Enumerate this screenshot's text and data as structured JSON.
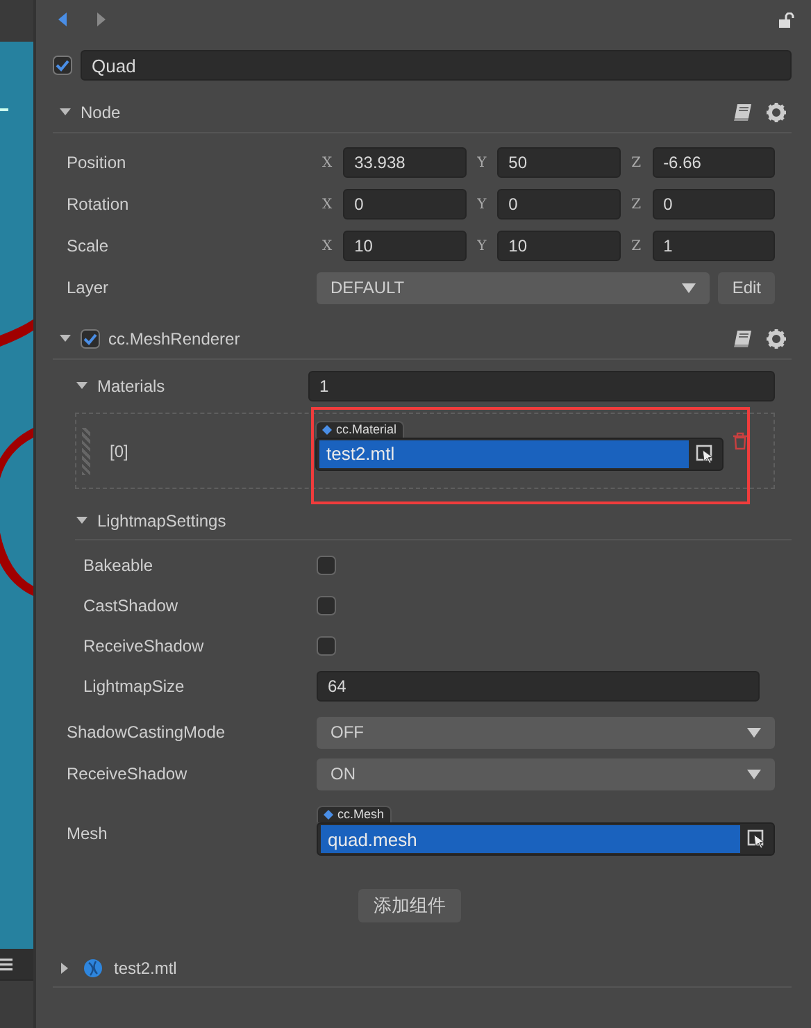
{
  "node": {
    "enabled": true,
    "name": "Quad"
  },
  "sections": [
    {
      "title": "Node",
      "expanded": true,
      "rows": [
        {
          "kind": "vec3",
          "label": "Position",
          "axes": [
            {
              "axis": "X",
              "value": "33.938"
            },
            {
              "axis": "Y",
              "value": "50"
            },
            {
              "axis": "Z",
              "value": "-6.66"
            }
          ]
        },
        {
          "kind": "vec3",
          "label": "Rotation",
          "axes": [
            {
              "axis": "X",
              "value": "0"
            },
            {
              "axis": "Y",
              "value": "0"
            },
            {
              "axis": "Z",
              "value": "0"
            }
          ]
        },
        {
          "kind": "vec3",
          "label": "Scale",
          "axes": [
            {
              "axis": "X",
              "value": "10"
            },
            {
              "axis": "Y",
              "value": "10"
            },
            {
              "axis": "Z",
              "value": "1"
            }
          ]
        },
        {
          "kind": "select",
          "label": "Layer",
          "value": "DEFAULT",
          "button": "Edit"
        }
      ]
    },
    {
      "title": "cc.MeshRenderer",
      "expanded": true,
      "enabled": true,
      "rows": [
        {
          "kind": "array",
          "label": "Materials",
          "expanded": true,
          "count": "1",
          "items": [
            {
              "index": "[0]",
              "type": "cc.Material",
              "value": "test2.mtl",
              "highlighted": true
            }
          ]
        },
        {
          "kind": "group",
          "label": "LightmapSettings",
          "expanded": true,
          "children": [
            {
              "kind": "checkbox",
              "label": "Bakeable",
              "checked": false
            },
            {
              "kind": "checkbox",
              "label": "CastShadow",
              "checked": false
            },
            {
              "kind": "checkbox",
              "label": "ReceiveShadow",
              "checked": false
            },
            {
              "kind": "number",
              "label": "LightmapSize",
              "value": "64"
            }
          ]
        },
        {
          "kind": "select",
          "label": "ShadowCastingMode",
          "value": "OFF"
        },
        {
          "kind": "select",
          "label": "ReceiveShadow",
          "value": "ON"
        },
        {
          "kind": "asset",
          "label": "Mesh",
          "type": "cc.Mesh",
          "value": "quad.mesh"
        }
      ]
    }
  ],
  "add_component_button": "添加组件",
  "assets": [
    {
      "name": "test2.mtl",
      "expanded": false
    }
  ]
}
